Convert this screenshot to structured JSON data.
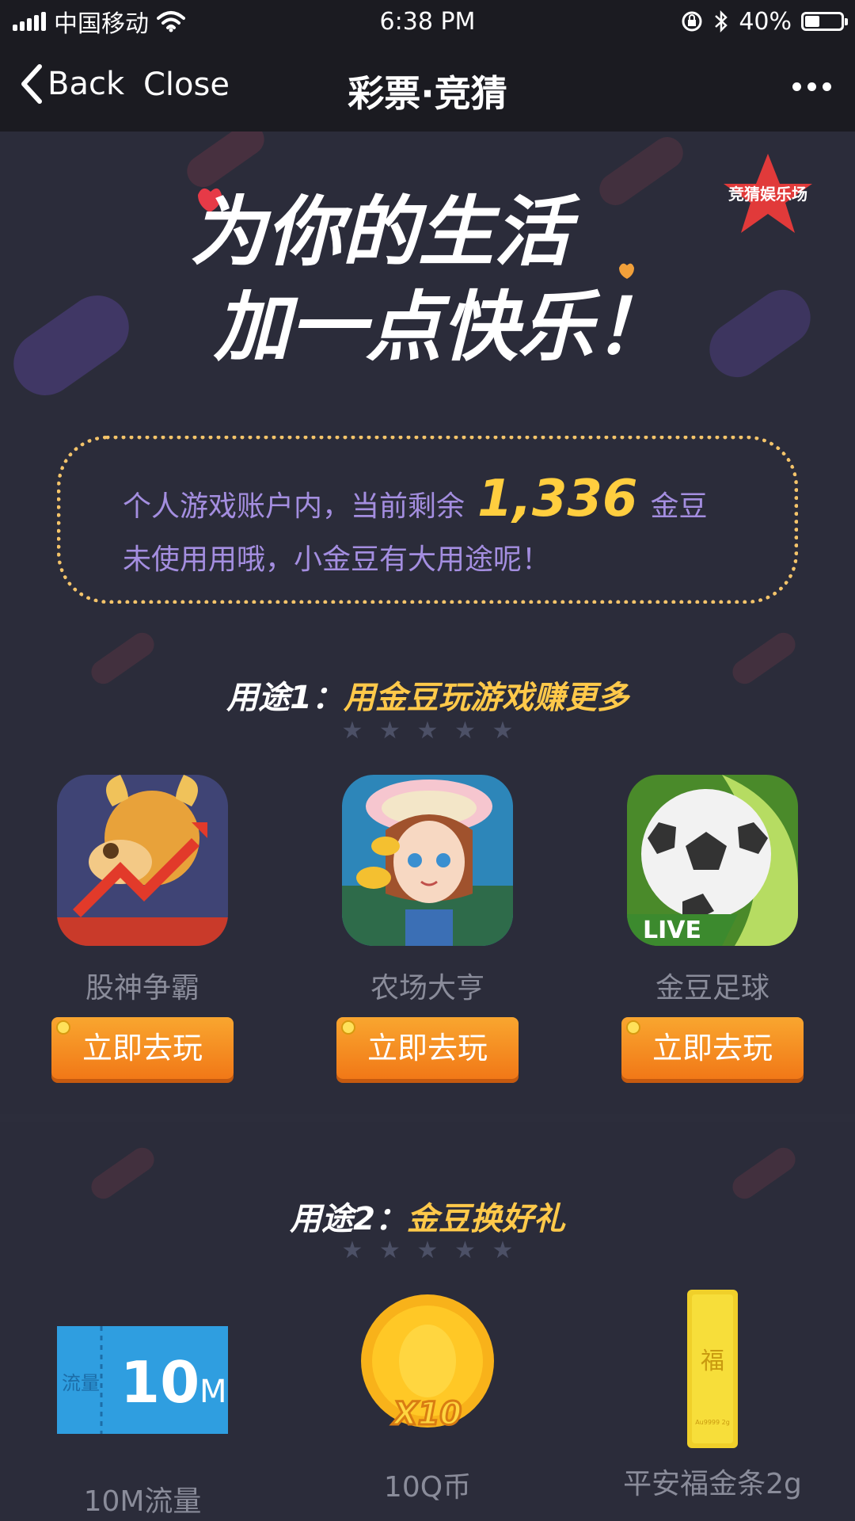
{
  "status_bar": {
    "carrier": "中国移动",
    "time": "6:38 PM",
    "battery": "40%",
    "battery_level": 0.4
  },
  "nav": {
    "back_label": "Back",
    "close_label": "Close",
    "title": "彩票·竞猜"
  },
  "hero": {
    "badge_text": "竞猜娱乐场",
    "slogan_line1": "为你的生活",
    "slogan_line2": "加一点快乐！"
  },
  "beans": {
    "prefix": "个人游戏账户内，当前剩余",
    "count": "1,336",
    "unit": "金豆",
    "line2": "未使用用哦，小金豆有大用途呢！"
  },
  "section1": {
    "title_lead": "用途1：",
    "title_main": "用金豆玩游戏赚更多",
    "games": [
      {
        "name": "股神争霸",
        "button": "立即去玩"
      },
      {
        "name": "农场大亨",
        "button": "立即去玩"
      },
      {
        "name": "金豆足球",
        "button": "立即去玩",
        "tag": "LIVE"
      }
    ]
  },
  "section2": {
    "title_lead": "用途2：",
    "title_main": "金豆换好礼",
    "gifts": [
      {
        "name": "10M流量",
        "card_big": "10",
        "card_small": "M",
        "card_side": "流量"
      },
      {
        "name": "10Q币",
        "coin_label": "X10"
      },
      {
        "name": "平安福金条2g",
        "bar_char": "福",
        "bar_small": "Au9999 2g"
      }
    ]
  },
  "colors": {
    "background": "#2c2d3b",
    "bar": "#1b1b21",
    "gold": "#ffc94a",
    "purple_text": "#a48ee0",
    "orange_button": "#f48b21"
  }
}
